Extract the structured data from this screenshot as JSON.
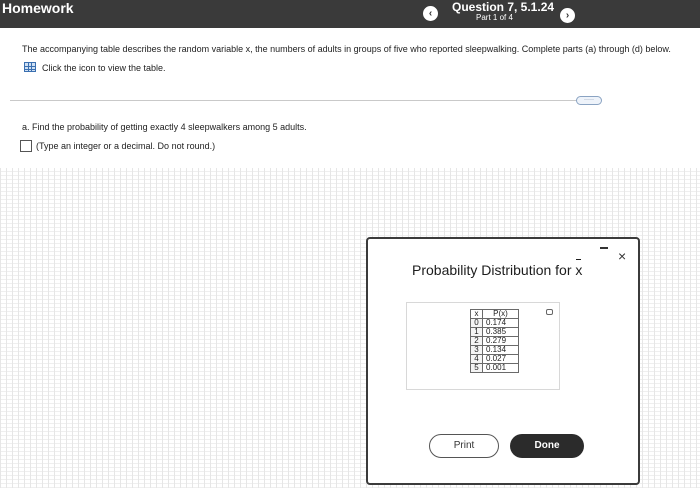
{
  "header": {
    "app_title": "Homework",
    "question_title": "Question 7, 5.1.24",
    "question_part": "Part 1 of 4",
    "prev_label": "‹",
    "next_label": "›"
  },
  "question": {
    "prompt": "The accompanying table describes the random variable x, the numbers of adults in groups of five who reported sleepwalking. Complete parts (a) through (d) below.",
    "table_link_text": "Click the icon to view the table.",
    "more_label": "·····"
  },
  "part_a": {
    "text": "a. Find the probability of getting exactly 4 sleepwalkers among 5 adults.",
    "answer_value": "",
    "hint": "(Type an integer or a decimal. Do not round.)"
  },
  "modal": {
    "title_prefix": "Probability Distribution for ",
    "title_var": "x",
    "minimize_icon": "minimize-icon",
    "close_label": "×",
    "table": {
      "headers": [
        "x",
        "P(x)"
      ],
      "rows": [
        [
          "0",
          "0.174"
        ],
        [
          "1",
          "0.385"
        ],
        [
          "2",
          "0.279"
        ],
        [
          "3",
          "0.134"
        ],
        [
          "4",
          "0.027"
        ],
        [
          "5",
          "0.001"
        ]
      ]
    },
    "print_label": "Print",
    "done_label": "Done"
  },
  "colors": {
    "header_bg": "#3a3a3a",
    "done_bg": "#2b2b2b",
    "link_icon": "#3a6fb0"
  }
}
